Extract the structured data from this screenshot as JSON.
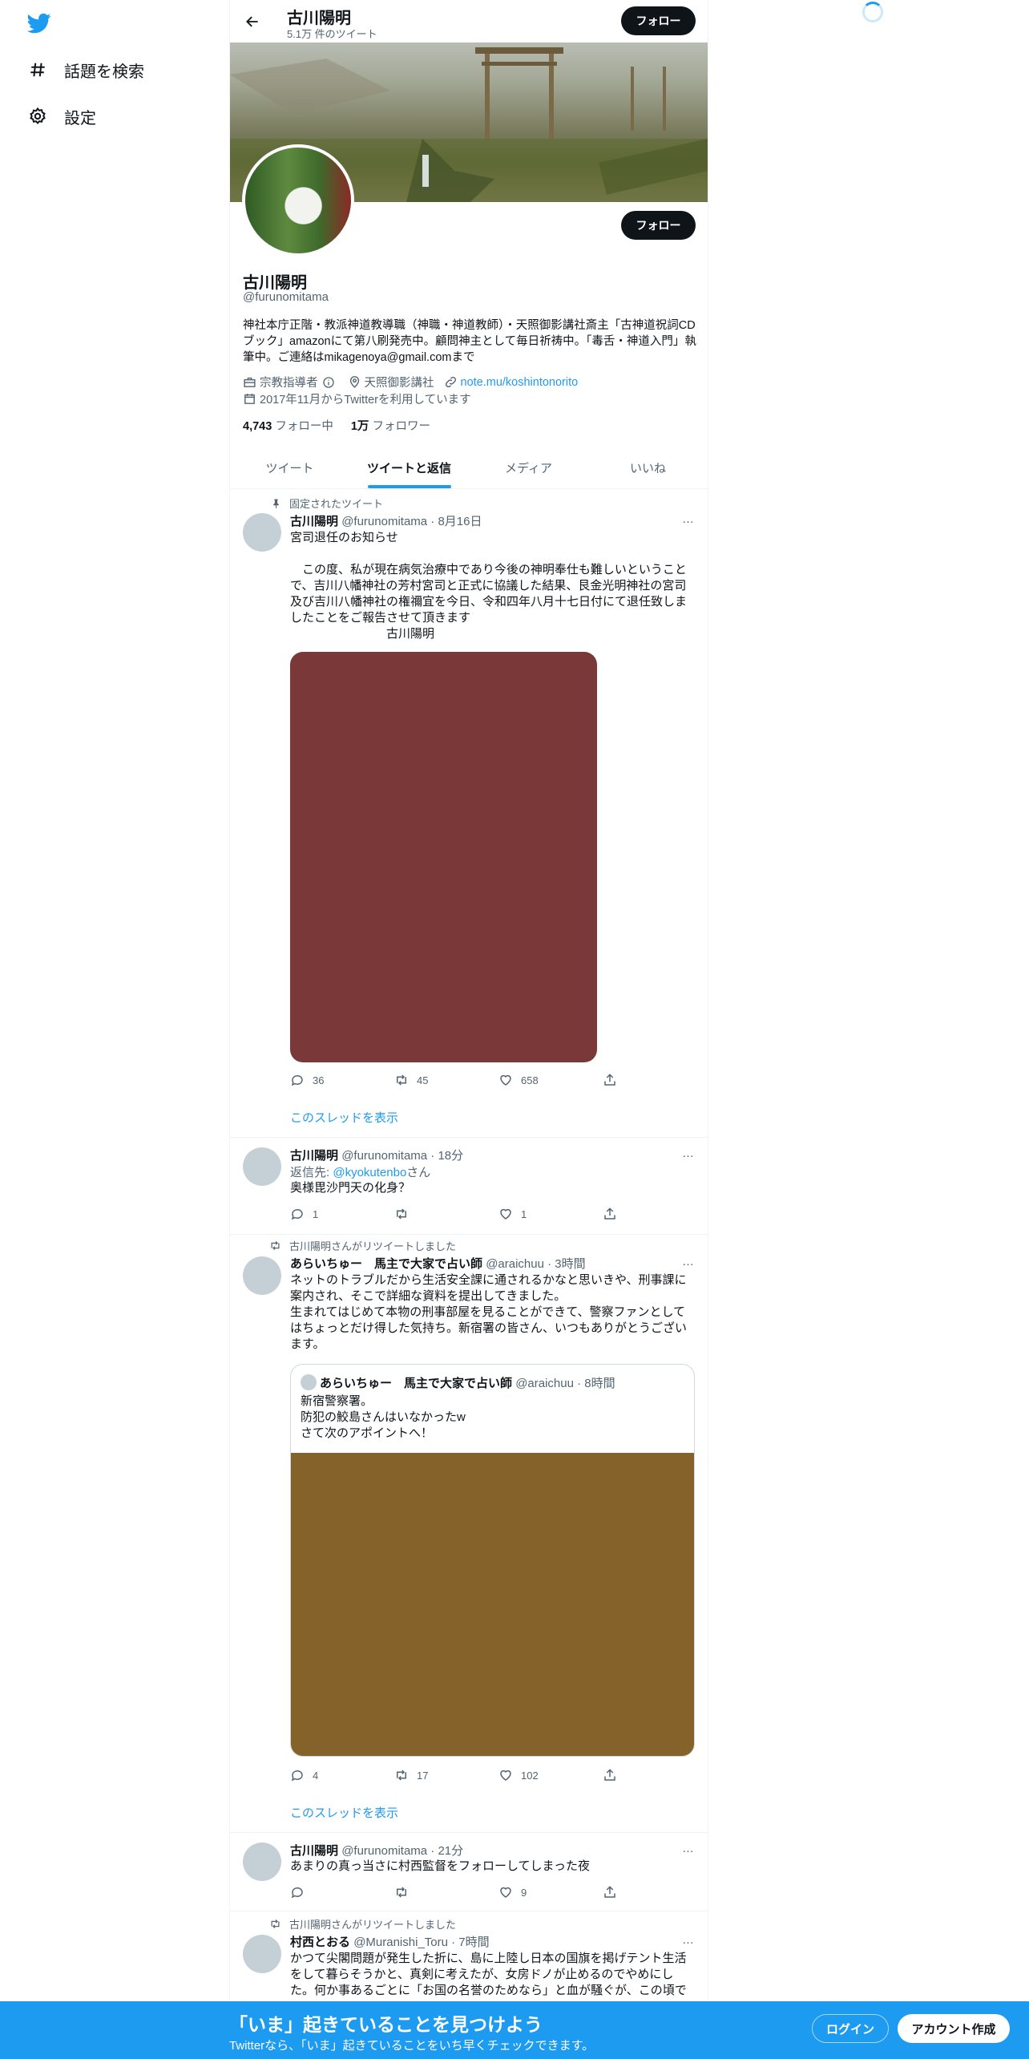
{
  "nav": {
    "explore_label": "話題を検索",
    "settings_label": "設定"
  },
  "profile": {
    "name": "古川陽明",
    "tweet_count": "5.1万 件のツイート",
    "follow_label": "フォロー",
    "handle": "@furunomitama",
    "bio": "神社本庁正階・教派神道教導職（神職・神道教師）・天照御影講社斎主「古神道祝詞CDブック」amazonにて第八刷発売中。顧問神主として毎日祈祷中。「毒舌・神道入門」執筆中。ご連絡はmikagenoya@gmail.comまで",
    "category": "宗教指導者",
    "location": "天照御影講社",
    "url": "note.mu/koshintonorito",
    "joined": "2017年11月からTwitterを利用しています",
    "following_count": "4,743",
    "following_label": "フォロー中",
    "followers_count": "1万",
    "followers_label": "フォロワー"
  },
  "tabs": [
    "ツイート",
    "ツイートと返信",
    "メディア",
    "いいね"
  ],
  "tweets": [
    {
      "context": "固定されたツイート",
      "name": "古川陽明",
      "meta": "@furunomitama · 8月16日",
      "text": "宮司退任のお知らせ\n\n　この度、私が現在病気治療中であり今後の神明奉仕も難しいということで、吉川八幡神社の芳村宮司と正式に協議した結果、艮金光明神社の宮司及び吉川八幡神社の権禰宜を今日、令和四年八月十七日付にて退任致しましたことをご報告させて頂きます\n　　　　　　　　古川陽明",
      "media_color": "#7a3838",
      "replies": "36",
      "retweets": "45",
      "likes": "658",
      "thread_label": "このスレッドを表示"
    },
    {
      "name": "古川陽明",
      "meta": "@furunomitama · 18分",
      "reply_prefix": "返信先: ",
      "reply_to": "@kyokutenbo",
      "reply_suffix": "さん",
      "text": "奥様毘沙門天の化身？",
      "replies": "1",
      "retweets": "",
      "likes": "1"
    },
    {
      "context": "古川陽明さんがリツイートしました",
      "name": "あらいちゅー　馬主で大家で占い師",
      "meta": "@araichuu · 3時間",
      "text": "ネットのトラブルだから生活安全課に通されるかなと思いきや、刑事課に案内され、そこで詳細な資料を提出してきました。\n生まれてはじめて本物の刑事部屋を見ることができて、警察ファンとしてはちょっとだけ得した気持ち。新宿署の皆さん、いつもありがとうございます。",
      "quote": {
        "name": "あらいちゅー　馬主で大家で占い師",
        "meta": "@araichuu · 8時間",
        "text": "新宿警察署。\n防犯の鮫島さんはいなかったw\nさて次のアポイントへ！",
        "media_color": "#85622a"
      },
      "replies": "4",
      "retweets": "17",
      "likes": "102",
      "thread_label": "このスレッドを表示"
    },
    {
      "name": "古川陽明",
      "meta": "@furunomitama · 21分",
      "text": "あまりの真っ当さに村西監督をフォローしてしまった夜",
      "replies": "",
      "retweets": "",
      "likes": "9"
    },
    {
      "context": "古川陽明さんがリツイートしました",
      "name": "村西とおる",
      "meta": "@Muranishi_Toru · 7時間",
      "text": "かつて尖閣問題が発生した折に、島に上陸し日本の国旗を掲げテント生活をして暮らそうかと、真剣に考えたが、女房ドノが止めるのでやめにした。何か事あるごとに「お国の名誉のためなら」と血が騒ぐが、この頃で"
    }
  ],
  "more_icon": "…",
  "bottom": {
    "title": "「いま」起きていることを見つけよう",
    "subtitle": "Twitterなら、「いま」起きていることをいち早くチェックできます。",
    "login_label": "ログイン",
    "signup_label": "アカウント作成"
  },
  "colors": {
    "accent": "#1d9bf0",
    "text": "#0f1419",
    "muted": "#536471"
  }
}
